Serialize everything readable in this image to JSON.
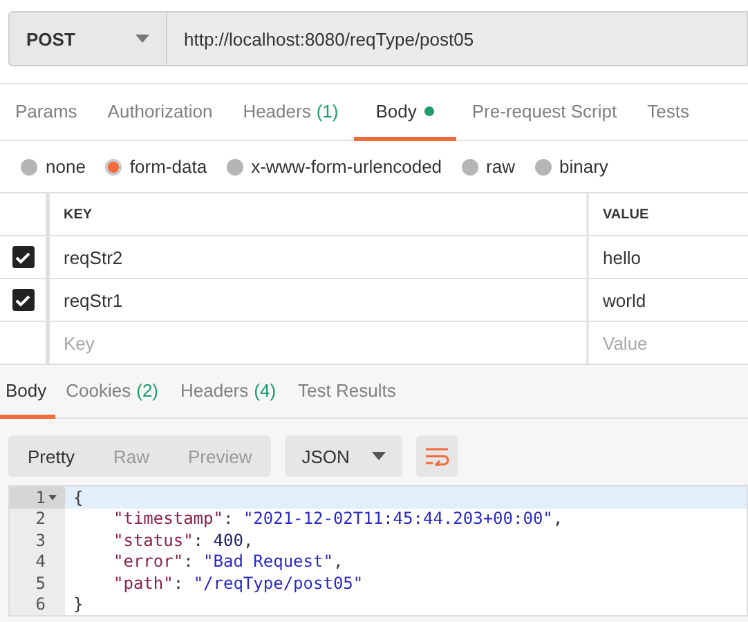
{
  "request": {
    "method": "POST",
    "url": "http://localhost:8080/reqType/post05"
  },
  "request_tabs": [
    {
      "label": "Params",
      "selected": false
    },
    {
      "label": "Authorization",
      "selected": false
    },
    {
      "label": "Headers",
      "count": "(1)",
      "selected": false
    },
    {
      "label": "Body",
      "selected": true,
      "indicator": true
    },
    {
      "label": "Pre-request Script",
      "selected": false
    },
    {
      "label": "Tests",
      "selected": false
    }
  ],
  "body_types": [
    {
      "label": "none",
      "selected": false
    },
    {
      "label": "form-data",
      "selected": true
    },
    {
      "label": "x-www-form-urlencoded",
      "selected": false
    },
    {
      "label": "raw",
      "selected": false
    },
    {
      "label": "binary",
      "selected": false
    }
  ],
  "params_table": {
    "columns": [
      "KEY",
      "VALUE"
    ],
    "rows": [
      {
        "key": "reqStr2",
        "value": "hello",
        "checked": true
      },
      {
        "key": "reqStr1",
        "value": "world",
        "checked": true
      }
    ],
    "new_row": {
      "key_placeholder": "Key",
      "value_placeholder": "Value"
    }
  },
  "response_tabs": [
    {
      "label": "Body",
      "selected": true
    },
    {
      "label": "Cookies",
      "count": "(2)",
      "selected": false
    },
    {
      "label": "Headers",
      "count": "(4)",
      "selected": false
    },
    {
      "label": "Test Results",
      "selected": false
    }
  ],
  "view_modes": [
    {
      "label": "Pretty",
      "selected": true
    },
    {
      "label": "Raw",
      "selected": false
    },
    {
      "label": "Preview",
      "selected": false
    }
  ],
  "format": "JSON",
  "code": [
    {
      "number": "1",
      "foldable": true,
      "current": true,
      "indented": false,
      "tokens": [
        {
          "kind": "punct",
          "text": "{"
        }
      ]
    },
    {
      "number": "2",
      "current": false,
      "indented": true,
      "tokens": [
        {
          "kind": "key",
          "text": "\"timestamp\""
        },
        {
          "kind": "punct",
          "text": ": "
        },
        {
          "kind": "string",
          "text": "\"2021-12-02T11:45:44.203+00:00\""
        },
        {
          "kind": "punct",
          "text": ","
        }
      ]
    },
    {
      "number": "3",
      "current": false,
      "indented": true,
      "tokens": [
        {
          "kind": "key",
          "text": "\"status\""
        },
        {
          "kind": "punct",
          "text": ": "
        },
        {
          "kind": "number",
          "text": "400"
        },
        {
          "kind": "punct",
          "text": ","
        }
      ]
    },
    {
      "number": "4",
      "current": false,
      "indented": true,
      "tokens": [
        {
          "kind": "key",
          "text": "\"error\""
        },
        {
          "kind": "punct",
          "text": ": "
        },
        {
          "kind": "string",
          "text": "\"Bad Request\""
        },
        {
          "kind": "punct",
          "text": ","
        }
      ]
    },
    {
      "number": "5",
      "current": false,
      "indented": true,
      "tokens": [
        {
          "kind": "key",
          "text": "\"path\""
        },
        {
          "kind": "punct",
          "text": ": "
        },
        {
          "kind": "string",
          "text": "\"/reqType/post05\""
        }
      ]
    },
    {
      "number": "6",
      "current": false,
      "indented": false,
      "tokens": [
        {
          "kind": "punct",
          "text": "}"
        }
      ]
    }
  ]
}
